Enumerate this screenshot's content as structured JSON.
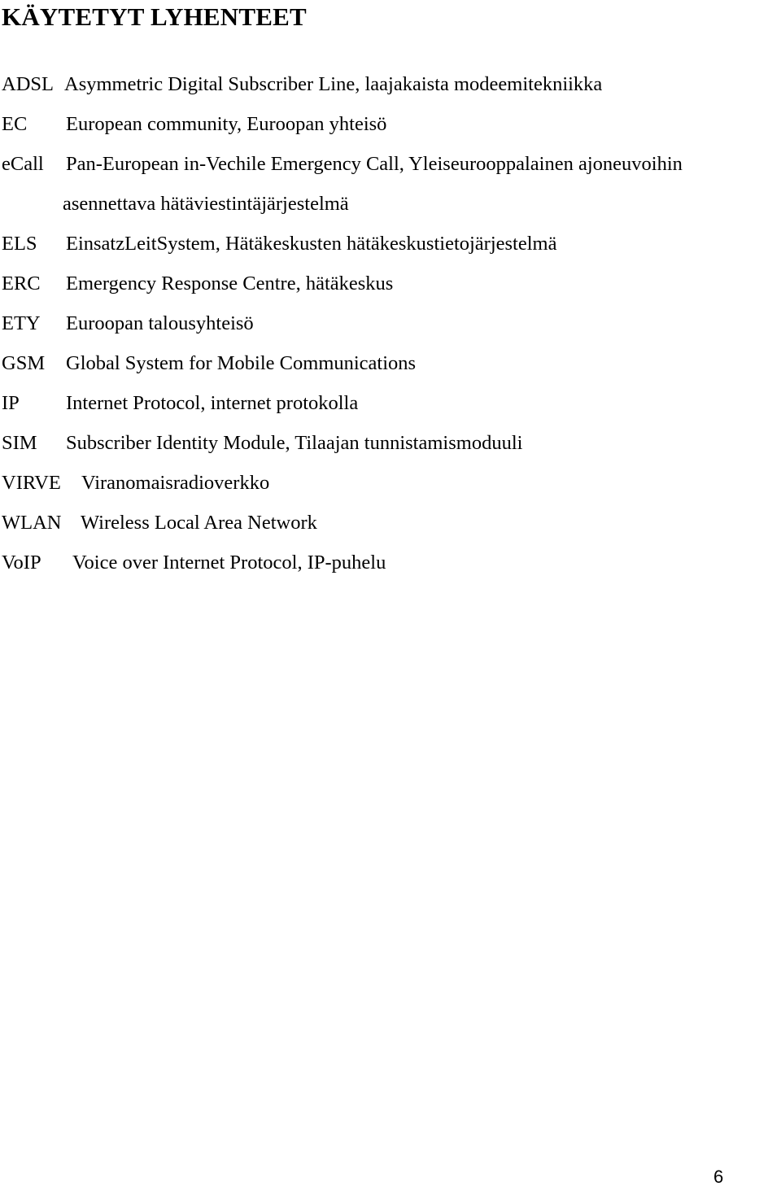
{
  "document": {
    "title": "KÄYTETYT LYHENTEET",
    "entries": [
      {
        "abbr": "ADSL",
        "desc": "Asymmetric Digital Subscriber Line, laajakaista modeemitekniikka"
      },
      {
        "abbr": "EC",
        "desc": "European community, Euroopan yhteisö"
      },
      {
        "abbr": "eCall",
        "desc": "Pan-European in-Vechile Emergency Call, Yleiseurooppalainen ajoneuvoihin"
      },
      {
        "abbr": "",
        "desc": "asennettava hätäviestintäjärjestelmä"
      },
      {
        "abbr": "ELS",
        "desc": "EinsatzLeitSystem, Hätäkeskusten hätäkeskustietojärjestelmä"
      },
      {
        "abbr": "ERC",
        "desc": "Emergency Response Centre, hätäkeskus"
      },
      {
        "abbr": "ETY",
        "desc": "Euroopan talousyhteisö"
      },
      {
        "abbr": "GSM",
        "desc": "Global System for Mobile Communications"
      },
      {
        "abbr": "IP",
        "desc": "Internet Protocol, internet protokolla"
      },
      {
        "abbr": "SIM",
        "desc": "Subscriber Identity Module, Tilaajan tunnistamismoduuli"
      },
      {
        "abbr": "VIRVE",
        "desc": "Viranomaisradioverkko"
      },
      {
        "abbr": "WLAN",
        "desc": "Wireless Local Area Network"
      },
      {
        "abbr": "VoIP",
        "desc": "Voice over Internet Protocol, IP-puhelu"
      }
    ],
    "page_number": "6"
  }
}
